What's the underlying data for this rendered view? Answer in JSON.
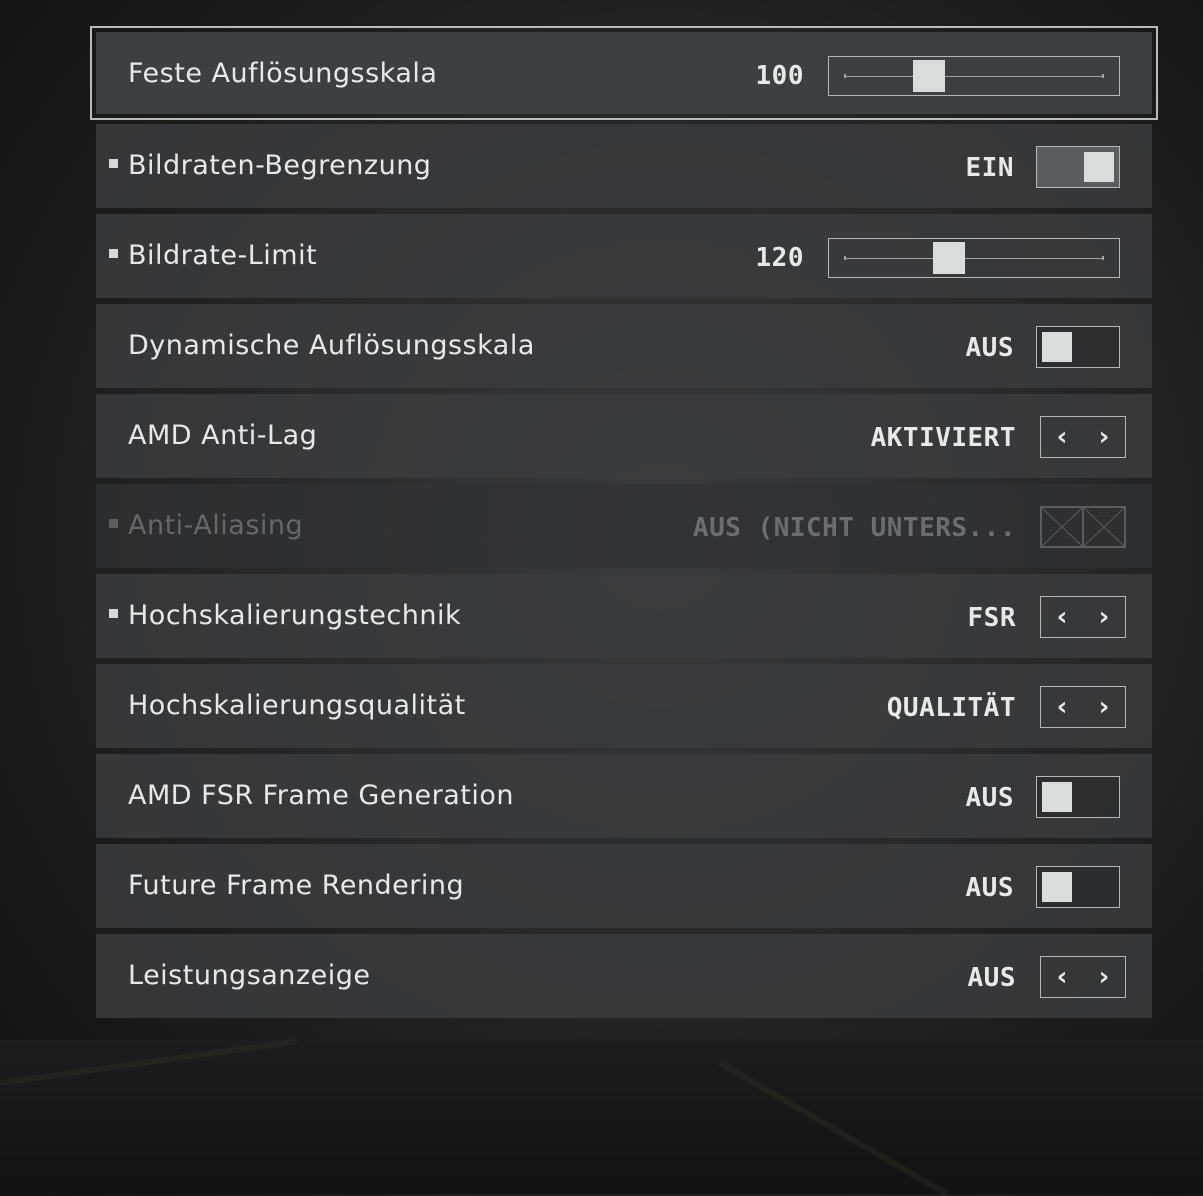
{
  "settings": [
    {
      "label": "Feste Auflösungsskala",
      "value": "100",
      "control": "slider",
      "selected": true,
      "bullet": false,
      "slider_fraction": 0.3
    },
    {
      "label": "Bildraten-Begrenzung",
      "value": "EIN",
      "control": "toggle",
      "state": "on",
      "bullet": true
    },
    {
      "label": "Bildrate-Limit",
      "value": "120",
      "control": "slider",
      "bullet": true,
      "slider_fraction": 0.39
    },
    {
      "label": "Dynamische Auflösungsskala",
      "value": "AUS",
      "control": "toggle",
      "state": "off",
      "bullet": false
    },
    {
      "label": "AMD Anti-Lag",
      "value": "AKTIVIERT",
      "control": "stepper",
      "bullet": false
    },
    {
      "label": "Anti-Aliasing",
      "value": "AUS (NICHT UNTERS...",
      "control": "stepper-disabled",
      "bullet": true,
      "disabled": true
    },
    {
      "label": "Hochskalierungstechnik",
      "value": "FSR",
      "control": "stepper",
      "bullet": true
    },
    {
      "label": "Hochskalierungsqualität",
      "value": "QUALITÄT",
      "control": "stepper",
      "bullet": false
    },
    {
      "label": "AMD FSR Frame Generation",
      "value": "AUS",
      "control": "toggle",
      "state": "off",
      "bullet": false
    },
    {
      "label": "Future Frame Rendering",
      "value": "AUS",
      "control": "toggle",
      "state": "off",
      "bullet": false
    },
    {
      "label": "Leistungsanzeige",
      "value": "AUS",
      "control": "stepper",
      "bullet": false
    }
  ],
  "icons": {
    "left": "chevron-left-icon",
    "right": "chevron-right-icon",
    "disabled": "crossed-box-icon"
  },
  "arrow_glyphs": {
    "left": "‹",
    "right": "›"
  },
  "colors": {
    "text": "#e6e8e9",
    "disabled_text": "#64686b",
    "row_bg": "#3a3d40",
    "outline": "#b9bcbd"
  }
}
